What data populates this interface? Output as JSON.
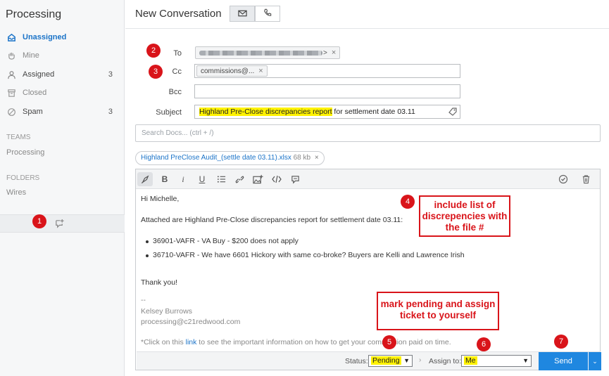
{
  "sidebar": {
    "title": "Processing",
    "items": [
      {
        "label": "Unassigned",
        "count": "",
        "icon": "inbox-icon"
      },
      {
        "label": "Mine",
        "count": "",
        "icon": "hand-icon"
      },
      {
        "label": "Assigned",
        "count": "3",
        "icon": "user-icon"
      },
      {
        "label": "Closed",
        "count": "",
        "icon": "archive-icon"
      },
      {
        "label": "Spam",
        "count": "3",
        "icon": "ban-icon"
      }
    ],
    "teams_heading": "TEAMS",
    "teams": [
      "Processing"
    ],
    "folders_heading": "FOLDERS",
    "folders": [
      "Wires"
    ]
  },
  "header": {
    "title": "New Conversation",
    "modes": [
      {
        "icon": "envelope-icon",
        "selected": true
      },
      {
        "icon": "phone-icon",
        "selected": false
      }
    ]
  },
  "form": {
    "to_label": "To",
    "cc_label": "Cc",
    "cc_chip": "commissions@...",
    "bcc_label": "Bcc",
    "subject_label": "Subject",
    "subject_highlighted": "Highland Pre-Close discrepancies report",
    "subject_rest": " for settlement date 03.11",
    "chip_close": "×"
  },
  "search": {
    "placeholder": "Search Docs... (ctrl + /)"
  },
  "attachment": {
    "name": "Highland PreClose Audit_(settle date 03.11).xlsx",
    "size": "68 kb"
  },
  "editor": {
    "greeting": "Hi Michelle,",
    "intro": "Attached are Highland Pre-Close discrepancies report for settlement date 03.11:",
    "bullets": [
      "36901-VAFR -  VA Buy - $200 does not apply",
      "36710-VAFR - We have 6601 Hickory with same co-broke? Buyers are Kelli and Lawrence Irish"
    ],
    "thanks": "Thank you!",
    "sig_dash": "--",
    "sig_name": "Kelsey Burrows",
    "sig_email": "processing@c21redwood.com",
    "footer_pre": "*Click on this ",
    "footer_link": "link",
    "footer_post": " to see the important information on how to get your commission paid on time."
  },
  "bottom": {
    "status_label": "Status:",
    "status_value": "Pending",
    "assign_label": "Assign to:",
    "assign_value": "Me",
    "send_label": "Send"
  },
  "annotations": {
    "badges": [
      "1",
      "2",
      "3",
      "4",
      "5",
      "6",
      "7"
    ],
    "callout_list": "include list of discrepencies with the file #",
    "callout_pending": "mark pending and assign ticket to yourself"
  },
  "colors": {
    "accent": "#1f87e0",
    "annotation_red": "#d9141a",
    "highlight": "#fff200"
  }
}
